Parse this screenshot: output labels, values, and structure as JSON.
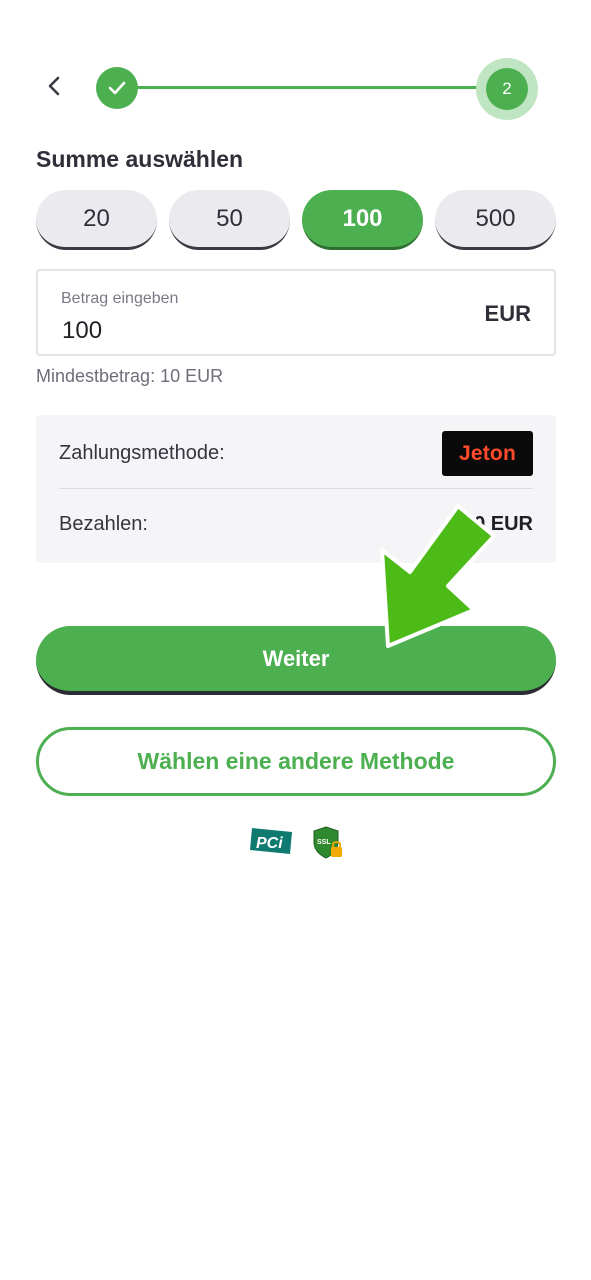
{
  "stepper": {
    "current_step": "2",
    "completed_step_icon": "check-icon",
    "back_icon": "chevron-left-icon",
    "accent": "#4caf50"
  },
  "amount_section": {
    "title": "Summe auswählen",
    "presets": [
      {
        "label": "20",
        "selected": false
      },
      {
        "label": "50",
        "selected": false
      },
      {
        "label": "100",
        "selected": true
      },
      {
        "label": "500",
        "selected": false
      }
    ],
    "input": {
      "label": "Betrag eingeben",
      "value": "100",
      "currency": "EUR"
    },
    "min_amount": "Mindestbetrag: 10 EUR"
  },
  "payment": {
    "method_label": "Zahlungsmethode:",
    "method_logo_text": "Jeton",
    "pay_label": "Bezahlen:",
    "pay_value": "100 EUR"
  },
  "actions": {
    "continue_label": "Weiter",
    "other_method_label": "Wählen eine andere Methode"
  },
  "security": {
    "pci_text": "PCi",
    "ssl_text": "SSL"
  },
  "overlay": {
    "arrow_icon": "pointer-arrow-icon",
    "arrow_color": "#4cbb17"
  }
}
